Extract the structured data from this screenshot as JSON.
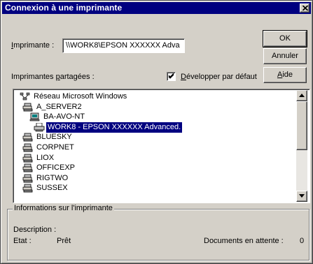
{
  "window": {
    "title": "Connexion à une imprimante"
  },
  "printer": {
    "label_prefix": "Imprimante :",
    "value": "\\\\WORK8\\EPSON XXXXXX Adva"
  },
  "shared": {
    "label": "Imprimantes partagées :",
    "expand_default_label": "Développer par défaut",
    "expand_default_checked": true
  },
  "buttons": {
    "ok": "OK",
    "cancel": "Annuler",
    "help": "Aide"
  },
  "tree": {
    "items": [
      {
        "label": "Réseau Microsoft Windows",
        "icon": "network-icon",
        "level": 0
      },
      {
        "label": "A_SERVER2",
        "icon": "server-icon",
        "level": 1
      },
      {
        "label": "BA-AVO-NT",
        "icon": "computer-icon",
        "level": 2
      },
      {
        "label": "WORK8 - EPSON XXXXXX Advanced.",
        "icon": "printer-icon",
        "level": 3,
        "selected": true
      },
      {
        "label": "BLUESKY",
        "icon": "server-icon",
        "level": 1
      },
      {
        "label": "CORPNET",
        "icon": "server-icon",
        "level": 1
      },
      {
        "label": "LIOX",
        "icon": "server-icon",
        "level": 1
      },
      {
        "label": "OFFICEXP",
        "icon": "server-icon",
        "level": 1
      },
      {
        "label": "RIGTWO",
        "icon": "server-icon",
        "level": 1
      },
      {
        "label": "SUSSEX",
        "icon": "server-icon",
        "level": 1
      }
    ]
  },
  "info": {
    "title": "Informations sur l'imprimante",
    "description_label": "Description :",
    "status_label": "Etat :",
    "status_value": "Prêt",
    "queue_label": "Documents en attente :",
    "queue_value": "0"
  },
  "colors": {
    "face": "#d4d0c8",
    "titlebar": "#000080",
    "selection": "#000080"
  }
}
